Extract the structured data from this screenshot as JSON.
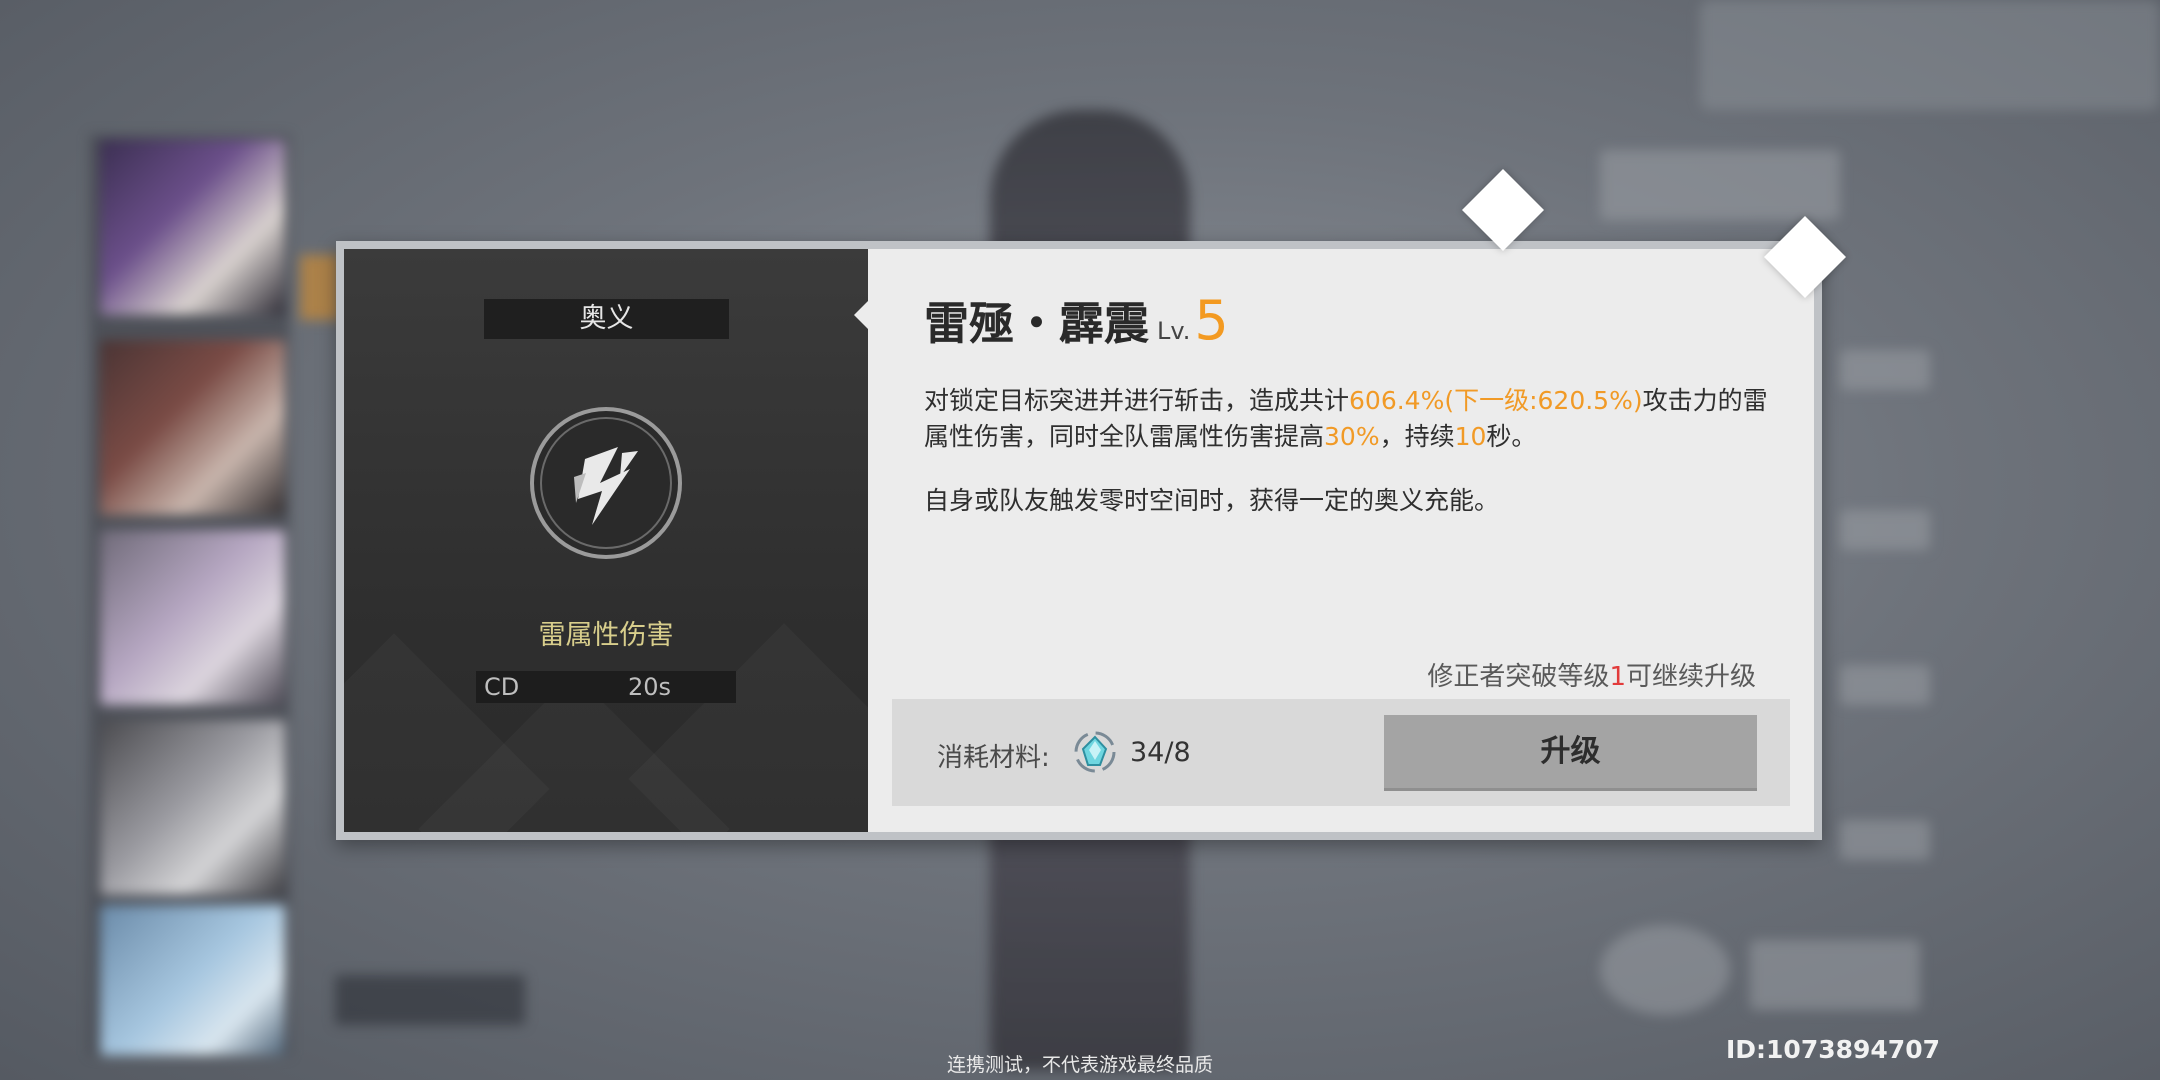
{
  "modal": {
    "skill_type": "奥义",
    "element": "雷属性伤害",
    "cd_label": "CD",
    "cd_value": "20s",
    "title": "雷殛・霹震",
    "level_prefix": "Lv.",
    "level": "5",
    "description": {
      "p1_a": "对锁定目标突进并进行斩击，造成共计",
      "p1_hl1": "606.4%(下一级:620.5%)",
      "p1_b": "攻击力的雷属性伤害，同时全队雷属性伤害提高",
      "p1_hl2": "30%",
      "p1_c": "，持续",
      "p1_hl3": "10",
      "p1_d": "秒。",
      "p2": "自身或队友触发零时空间时，获得一定的奥义充能。"
    },
    "breakthrough_note_a": "修正者突破等级",
    "breakthrough_note_num": "1",
    "breakthrough_note_b": "可继续升级",
    "material_label": "消耗材料:",
    "material_icon": "crystal-material-icon",
    "material_count": "34/8",
    "upgrade_label": "升级"
  },
  "footer": {
    "test_notice": "连携测试，不代表游戏最终品质",
    "player_id": "ID:1073894707"
  },
  "colors": {
    "accent_orange": "#f39a21",
    "element_yellow": "#d8ce8c",
    "warning_red": "#e23b3b"
  }
}
